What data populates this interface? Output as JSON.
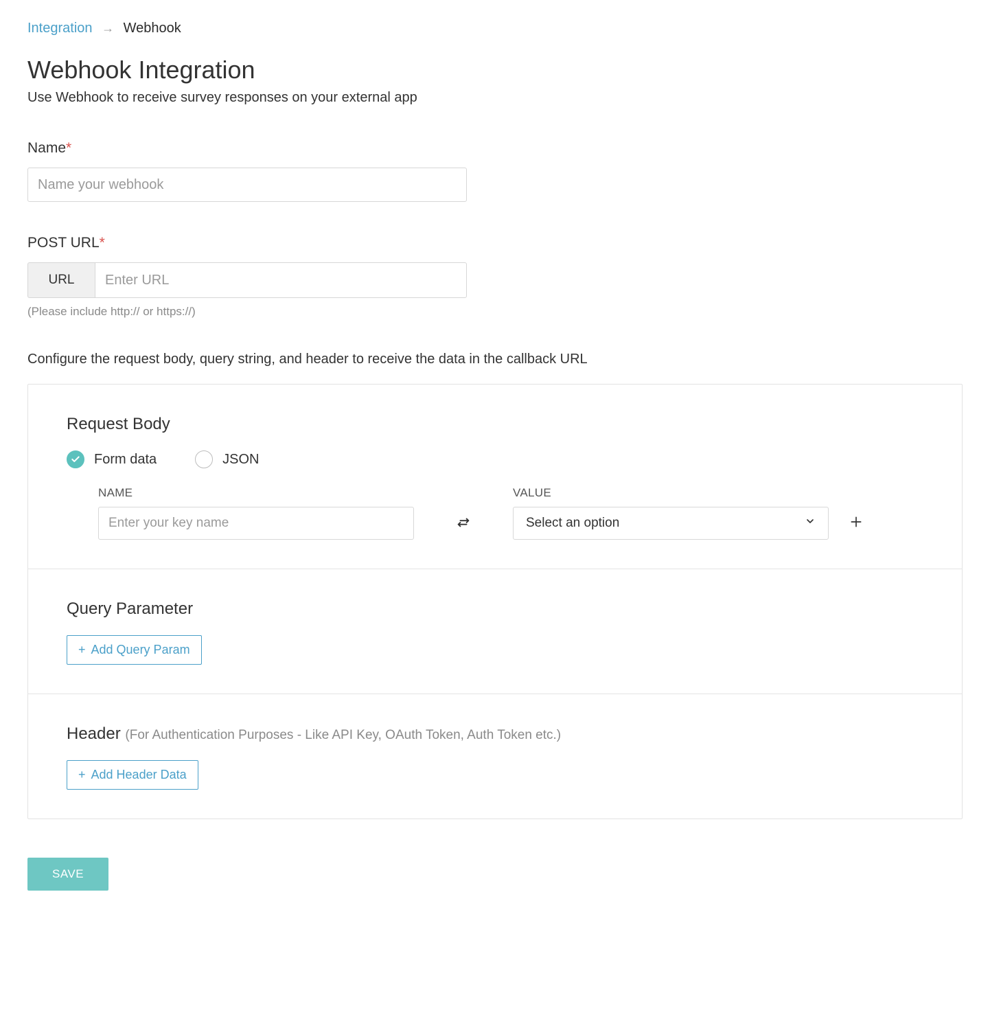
{
  "breadcrumb": {
    "parent": "Integration",
    "current": "Webhook"
  },
  "page": {
    "title": "Webhook Integration",
    "subtitle": "Use Webhook to receive survey responses on your external app"
  },
  "fields": {
    "name": {
      "label": "Name",
      "placeholder": "Name your webhook",
      "value": ""
    },
    "post_url": {
      "label": "POST URL",
      "prefix": "URL",
      "placeholder": "Enter URL",
      "value": "",
      "hint": "(Please include http:// or https://)"
    }
  },
  "configure_note": "Configure the request body, query string, and header to receive the data in the callback URL",
  "request_body": {
    "heading": "Request Body",
    "options": {
      "form_data": "Form data",
      "json": "JSON"
    },
    "selected": "form_data",
    "columns": {
      "name": "NAME",
      "value": "VALUE"
    },
    "row": {
      "key_placeholder": "Enter your key name",
      "key_value": "",
      "value_selected": "Select an option"
    }
  },
  "query_param": {
    "heading": "Query Parameter",
    "add_label": "Add Query Param"
  },
  "header": {
    "heading": "Header",
    "sub": "(For Authentication Purposes - Like API Key, OAuth Token, Auth Token etc.)",
    "add_label": "Add Header Data"
  },
  "save_label": "SAVE"
}
